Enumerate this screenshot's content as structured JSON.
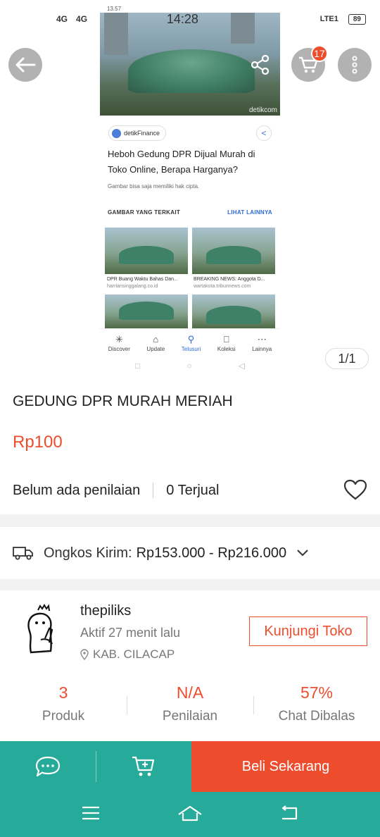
{
  "status_bar": {
    "network_1": "4G",
    "network_2": "4G",
    "time": "14:28",
    "lte": "LTE1",
    "battery": "89"
  },
  "screenshot": {
    "status_time": "13.57",
    "source_name": "detikFinance",
    "headline": "Heboh Gedung DPR Dijual Murah di Toko Online, Berapa Harganya?",
    "copyright_note": "Gambar bisa saja memiliki hak cipta.",
    "related_heading": "GAMBAR YANG TERKAIT",
    "related_more": "LIHAT LAINNYA",
    "watermark": "detikcom",
    "related": [
      {
        "caption": "DPR Buang Waktu Bahas Dan...",
        "url": "harriansinggalang.co.id"
      },
      {
        "caption": "BREAKING NEWS: Anggota D...",
        "url": "wartakota.tribunnews.com"
      }
    ],
    "nav": [
      {
        "label": "Discover",
        "icon": "asterisk-icon"
      },
      {
        "label": "Update",
        "icon": "update-icon"
      },
      {
        "label": "Telusuri",
        "icon": "search-icon"
      },
      {
        "label": "Koleksi",
        "icon": "bookmark-icon"
      },
      {
        "label": "Lainnya",
        "icon": "more-icon"
      }
    ]
  },
  "media": {
    "cart_count": "17",
    "image_counter": "1/1"
  },
  "product": {
    "title": "GEDUNG DPR MURAH MERIAH",
    "price": "Rp100",
    "rating_text": "Belum ada penilaian",
    "sold_text": "0 Terjual"
  },
  "shipping": {
    "label": "Ongkos Kirim:",
    "range": "Rp153.000 - Rp216.000"
  },
  "shop": {
    "name": "thepiliks",
    "active": "Aktif 27 menit lalu",
    "location": "KAB. CILACAP",
    "visit_label": "Kunjungi Toko",
    "stats": [
      {
        "value": "3",
        "label": "Produk"
      },
      {
        "value": "N/A",
        "label": "Penilaian"
      },
      {
        "value": "57%",
        "label": "Chat Dibalas"
      }
    ]
  },
  "actions": {
    "buy_now": "Beli Sekarang"
  },
  "colors": {
    "accent": "#ee4d2d",
    "teal": "#26aa99"
  }
}
